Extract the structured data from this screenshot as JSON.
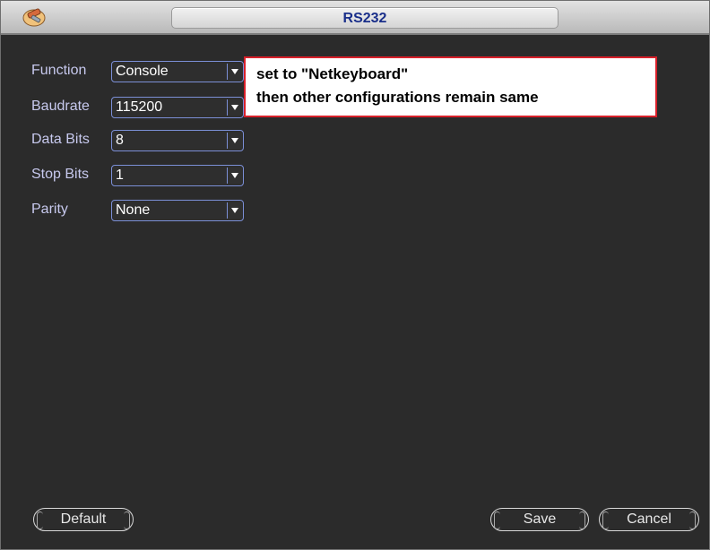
{
  "window": {
    "title": "RS232"
  },
  "fields": [
    {
      "label": "Function",
      "value": "Console"
    },
    {
      "label": "Baudrate",
      "value": "115200"
    },
    {
      "label": "Data Bits",
      "value": "8"
    },
    {
      "label": "Stop Bits",
      "value": "1"
    },
    {
      "label": "Parity",
      "value": "None"
    }
  ],
  "callout": {
    "line1": "set to \"Netkeyboard\"",
    "line2": "then other configurations remain same"
  },
  "buttons": {
    "default": "Default",
    "save": "Save",
    "cancel": "Cancel"
  },
  "colors": {
    "label": "#c7c9ee",
    "title": "#1a2f8a",
    "callout_border": "#d8202a"
  }
}
